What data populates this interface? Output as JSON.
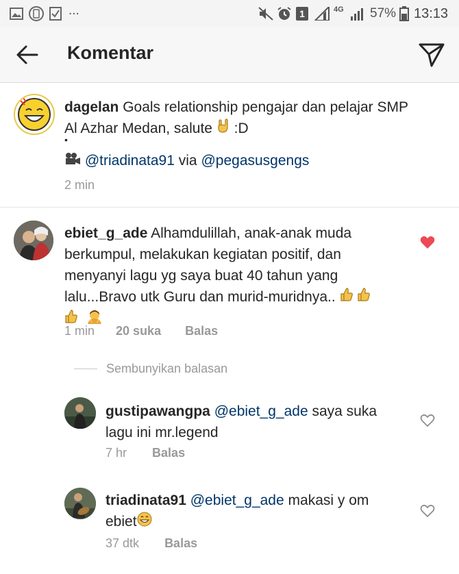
{
  "status_bar": {
    "dots": "...",
    "sim_badge": "1",
    "network": "4G",
    "battery": "57%",
    "time": "13:13"
  },
  "header": {
    "title": "Komentar"
  },
  "caption": {
    "username": "dagelan",
    "text": "Goals relationship pengajar dan pelajar SMP Al Azhar Medan, salute",
    "text_suffix": ":D",
    "bullet": "•",
    "credit_mention_1": "@triadinata91",
    "credit_via": "via",
    "credit_mention_2": "@pegasusgengs",
    "time": "2 min"
  },
  "comments": [
    {
      "username": "ebiet_g_ade",
      "text_line1": "Alhamdulillah, anak-anak muda",
      "text_line2": "berkumpul, melakukan kegiatan positif, dan",
      "text_line3": "menyanyi lagu yg saya buat 40 tahun yang",
      "text_line4": "lalu...Bravo utk Guru dan murid-muridnya..",
      "time": "1 min",
      "likes": "20 suka",
      "reply": "Balas",
      "liked": true
    }
  ],
  "hide_replies": "Sembunyikan balasan",
  "replies": [
    {
      "username": "gustipawangpa",
      "mention": "@ebiet_g_ade",
      "text_line1": "saya suka",
      "text_line2": "lagu ini mr.legend",
      "time": "7 hr",
      "reply": "Balas"
    },
    {
      "username": "triadinata91",
      "mention": "@ebiet_g_ade",
      "text_line1": "makasi y om",
      "text_line2": "ebiet",
      "time": "37 dtk",
      "reply": "Balas"
    }
  ],
  "colors": {
    "heart_liked": "#ed4956",
    "mention": "#003569",
    "meta": "#999999"
  }
}
